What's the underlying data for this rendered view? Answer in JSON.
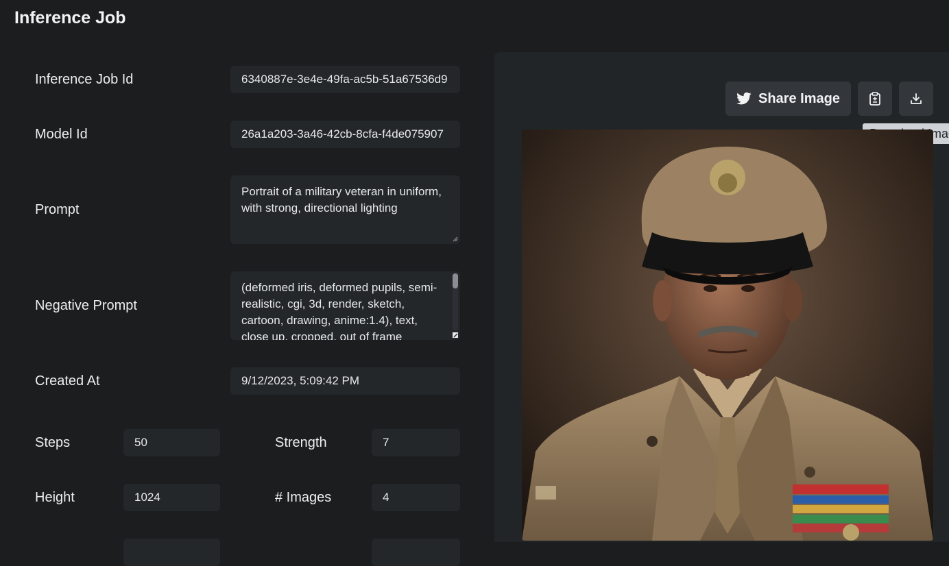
{
  "page": {
    "title": "Inference Job"
  },
  "form": {
    "job_id": {
      "label": "Inference Job Id",
      "value": "6340887e-3e4e-49fa-ac5b-51a67536d9"
    },
    "model_id": {
      "label": "Model Id",
      "value": "26a1a203-3a46-42cb-8cfa-f4de075907"
    },
    "prompt": {
      "label": "Prompt",
      "value": "Portrait of a military veteran in uniform, with strong, directional lighting"
    },
    "negative_prompt": {
      "label": "Negative Prompt",
      "value": "(deformed iris, deformed pupils, semi-realistic, cgi, 3d, render, sketch, cartoon, drawing, anime:1.4), text, close up, cropped, out of frame"
    },
    "created_at": {
      "label": "Created At",
      "value": "9/12/2023, 5:09:42 PM"
    },
    "steps": {
      "label": "Steps",
      "value": "50"
    },
    "strength": {
      "label": "Strength",
      "value": "7"
    },
    "height": {
      "label": "Height",
      "value": "1024"
    },
    "num_images": {
      "label": "# Images",
      "value": "4"
    }
  },
  "actions": {
    "share_label": "Share Image",
    "share_icon": "twitter-icon",
    "copy_icon": "clipboard-icon",
    "download_icon": "download-icon",
    "tooltip": "Download Image"
  },
  "image": {
    "subject": "military-veteran-portrait"
  },
  "colors": {
    "background": "#1b1d1f",
    "field": "#24272a",
    "panel": "#222528",
    "button": "#33373b"
  }
}
